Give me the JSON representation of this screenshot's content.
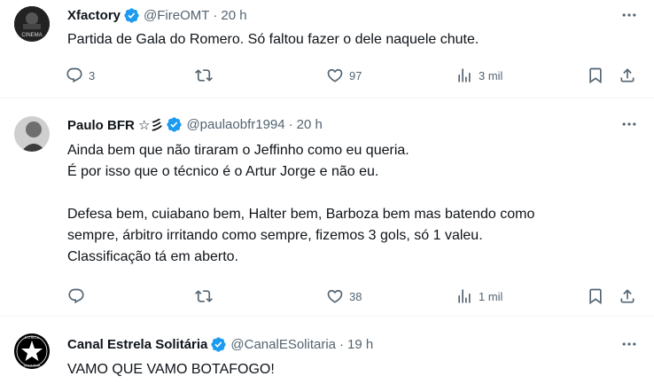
{
  "tweets": [
    {
      "name": "Xfactory",
      "handle": "@FireOMT",
      "time": "20 h",
      "avatar_text": "CINEMA",
      "text_lines": [
        "Partida de Gala do Romero. Só faltou fazer o dele naquele chute."
      ],
      "replies": "3",
      "retweets": "",
      "likes": "97",
      "views": "3 mil"
    },
    {
      "name": "Paulo BFR ☆彡",
      "handle": "@paulaobfr1994",
      "time": "20 h",
      "text_lines": [
        "Ainda bem que não tiraram o Jeffinho como eu queria.",
        "É por isso que o técnico é o Artur Jorge e não eu.",
        "",
        "Defesa bem, cuiabano bem, Halter bem, Barboza bem mas batendo como",
        "sempre, árbitro irritando como sempre, fizemos 3 gols, só 1 valeu.",
        "Classificação tá em aberto."
      ],
      "replies": "",
      "retweets": "",
      "likes": "38",
      "views": "1 mil"
    },
    {
      "name": "Canal Estrela Solitária",
      "handle": "@CanalESolitaria",
      "time": "19 h",
      "avatar_text_top": "ESTRELA",
      "avatar_text_bottom": "SOLITÁRIA",
      "text_lines": [
        "VAMO QUE VAMO BOTAFOGO!"
      ]
    }
  ],
  "separator": "·",
  "colors": {
    "verified": "#1d9bf0",
    "muted": "#536471",
    "text": "#0f1419"
  },
  "icons": [
    "reply-icon",
    "retweet-icon",
    "like-icon",
    "views-icon",
    "bookmark-icon",
    "share-icon",
    "more-icon",
    "verified-badge-icon"
  ]
}
